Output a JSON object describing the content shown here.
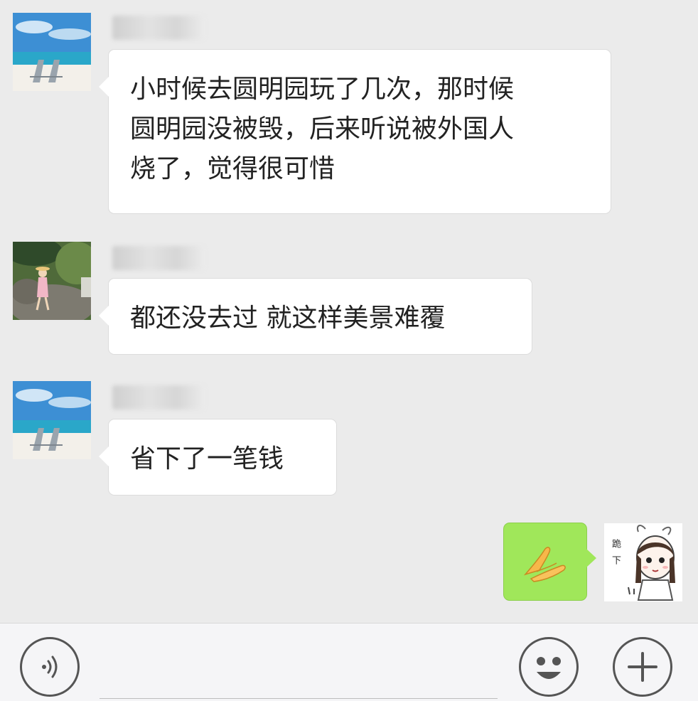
{
  "messages": [
    {
      "sender": "other",
      "nickname": "",
      "text_lines": [
        "小时候去圆明园玩了几次，那时候",
        "圆明园没被毁，后来听说被外国人",
        "烧了，觉得很可惜"
      ]
    },
    {
      "sender": "other",
      "nickname": "",
      "text_lines": [
        "都还没去过 就这样美景难覆"
      ]
    },
    {
      "sender": "other",
      "nickname": "",
      "text_lines": [
        "省下了一笔钱"
      ]
    },
    {
      "sender": "me",
      "content_icon": "clasped-hands-emoji-icon",
      "avatar_caption": "跪下"
    }
  ],
  "input_bar": {
    "voice_icon": "voice-icon",
    "emoji_icon": "smiley-icon",
    "more_icon": "plus-icon"
  },
  "colors": {
    "background": "#ebebeb",
    "bubble_other": "#ffffff",
    "bubble_me": "#a0e75a"
  }
}
